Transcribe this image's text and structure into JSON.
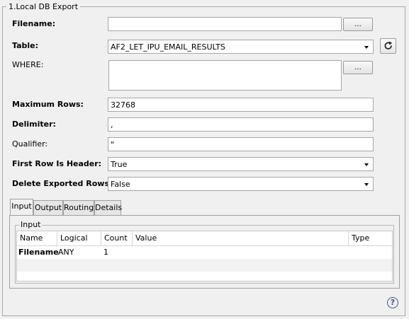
{
  "group_title": "1.Local DB Export",
  "labels": {
    "filename": "Filename:",
    "table": "Table:",
    "where": "WHERE:",
    "max_rows": "Maximum Rows:",
    "delimiter": "Delimiter:",
    "qualifier": "Qualifier:",
    "first_row_header": "First Row Is Header:",
    "delete_exported": "Delete Exported Rows:"
  },
  "values": {
    "filename": "",
    "table": "AF2_LET_IPU_EMAIL_RESULTS",
    "where": "",
    "max_rows": "32768",
    "delimiter": ",",
    "qualifier": "\"",
    "first_row_header": "True",
    "delete_exported": "False"
  },
  "buttons": {
    "browse_filename": "...",
    "browse_where": "..."
  },
  "tabs": [
    "Input",
    "Output",
    "Routing",
    "Details"
  ],
  "active_tab": "Input",
  "input_group_title": "Input",
  "grid": {
    "columns": [
      "Name",
      "Logical",
      "Count",
      "Value",
      "Type"
    ],
    "rows": [
      {
        "name": "Filename",
        "logical": "ANY",
        "count": "1",
        "value": "",
        "type": ""
      }
    ]
  },
  "icons": {
    "refresh": "refresh-icon",
    "help": "help-icon"
  },
  "help_glyph": "?"
}
